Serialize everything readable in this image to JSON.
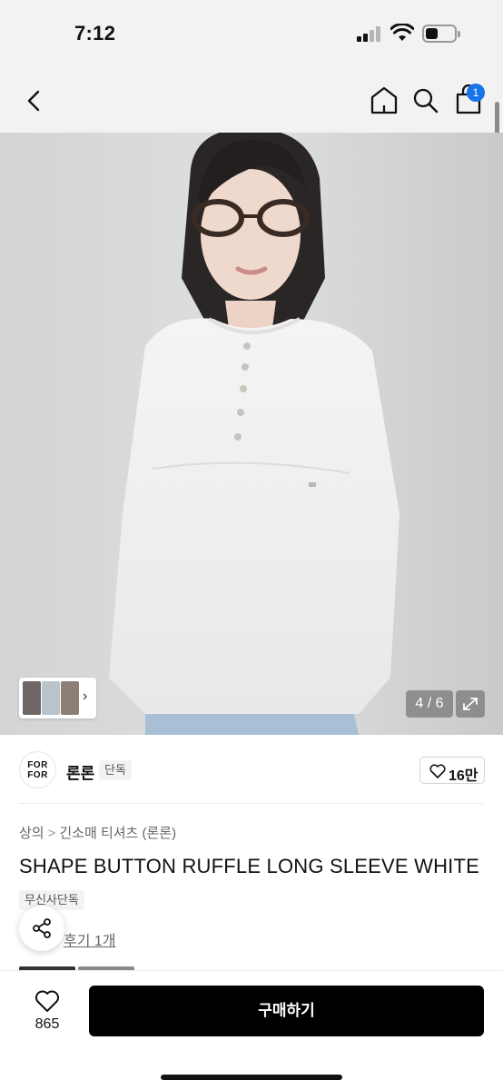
{
  "status_bar": {
    "time": "7:12"
  },
  "nav": {
    "cart_badge": "1"
  },
  "gallery": {
    "counter": "4 / 6"
  },
  "brand": {
    "logo_text_line1": "FOR",
    "logo_text_line2": "FOR",
    "name": "론론",
    "tag": "단독",
    "like_count": "16만"
  },
  "product": {
    "breadcrumb": [
      "상의",
      "긴소매 티셔츠 (론론)"
    ],
    "breadcrumb_separator": ">",
    "title": "SHAPE BUTTON RUFFLE LONG SLEEVE WHITE",
    "exclusive_tag": "무신사단독",
    "review_link": "후기 1개"
  },
  "bottom_bar": {
    "wish_count": "865",
    "buy_label": "구매하기"
  },
  "colors": {
    "accent_badge": "#1774e8",
    "buy_button": "#000000",
    "header_bg": "#f2f2f2"
  },
  "icons": [
    "back-icon",
    "home-icon",
    "search-icon",
    "cart-icon",
    "expand-icon",
    "heart-icon",
    "share-icon",
    "chevron-right-icon"
  ]
}
